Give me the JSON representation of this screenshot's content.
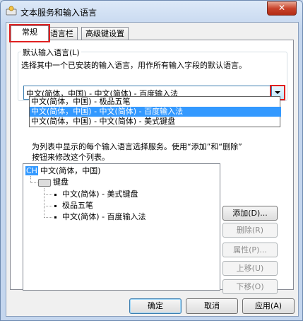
{
  "window": {
    "title": "文本服务和输入语言",
    "close_glyph": "✕"
  },
  "tabs": [
    {
      "label": "常规",
      "active": true
    },
    {
      "label": "语言栏",
      "active": false
    },
    {
      "label": "高级键设置",
      "active": false
    }
  ],
  "default_language": {
    "legend": "默认输入语言(L)",
    "description": "选择其中一个已安装的输入语言，用作所有输入字段的默认语言。",
    "selected_value": "中文(简体，中国) - 中文(简体) - 百度输入法",
    "options": [
      {
        "label": "中文(简体，中国) - 极品五笔",
        "selected": false
      },
      {
        "label": "中文(简体，中国) - 中文(简体) - 百度输入法",
        "selected": true
      },
      {
        "label": "中文(简体，中国) - 中文(简体) - 美式键盘",
        "selected": false
      }
    ]
  },
  "installed_services": {
    "description_line1": "为列表中显示的每个输入语言选择服务。使用“添加”和“删除”",
    "description_line2": "按钮来修改这个列表。",
    "tree": {
      "language_badge": "CH",
      "language": "中文(简体，中国)",
      "category": "键盘",
      "items": [
        "中文(简体) - 美式键盘",
        "极品五笔",
        "中文(简体) - 百度输入法"
      ]
    }
  },
  "side_buttons": {
    "add": "添加(D)...",
    "remove": "删除(R)",
    "properties": "属性(P)...",
    "move_up": "上移(U)",
    "move_down": "下移(O)"
  },
  "bottom_buttons": {
    "ok": "确定",
    "cancel": "取消",
    "apply": "应用(A)"
  },
  "colors": {
    "selection": "#3399ff",
    "annotation_red": "#e02020"
  }
}
